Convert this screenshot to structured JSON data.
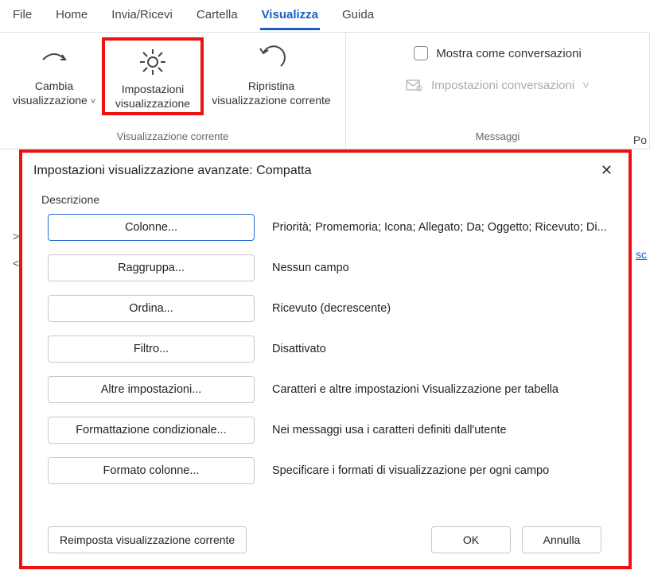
{
  "tabs": {
    "file": "File",
    "home": "Home",
    "send_recv": "Invia/Ricevi",
    "folder": "Cartella",
    "view": "Visualizza",
    "help": "Guida"
  },
  "ribbon": {
    "current_view_group": {
      "change_view": {
        "line1": "Cambia",
        "line2": "visualizzazione"
      },
      "view_settings": {
        "line1": "Impostazioni",
        "line2": "visualizzazione"
      },
      "reset_view": {
        "line1": "Ripristina",
        "line2": "visualizzazione corrente"
      },
      "group_title": "Visualizzazione corrente"
    },
    "messages_group": {
      "show_as_conv": "Mostra come conversazioni",
      "conv_settings": "Impostazioni conversazioni",
      "group_title": "Messaggi"
    },
    "right_cut": "Po"
  },
  "sidebar_hint": {
    "gt": ">",
    "lt": "<",
    "link_suffix": "sc"
  },
  "dialog": {
    "title": "Impostazioni visualizzazione avanzate: Compatta",
    "section": "Descrizione",
    "rows": [
      {
        "button": "Colonne...",
        "desc": "Priorità; Promemoria; Icona; Allegato; Da; Oggetto; Ricevuto; Di..."
      },
      {
        "button": "Raggruppa...",
        "desc": "Nessun campo"
      },
      {
        "button": "Ordina...",
        "desc": "Ricevuto (decrescente)"
      },
      {
        "button": "Filtro...",
        "desc": "Disattivato"
      },
      {
        "button": "Altre impostazioni...",
        "desc": "Caratteri e altre impostazioni Visualizzazione per tabella"
      },
      {
        "button": "Formattazione condizionale...",
        "desc": "Nei messaggi usa i caratteri definiti dall'utente"
      },
      {
        "button": "Formato colonne...",
        "desc": "Specificare i formati di visualizzazione per ogni campo"
      }
    ],
    "reset": "Reimposta visualizzazione corrente",
    "ok": "OK",
    "cancel": "Annulla"
  }
}
